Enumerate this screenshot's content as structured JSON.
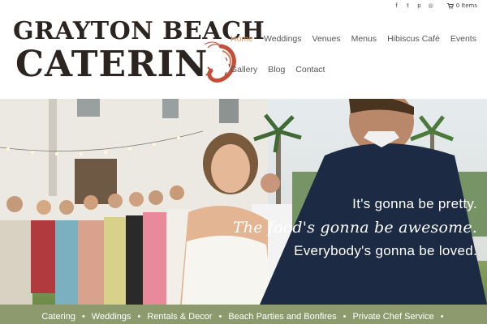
{
  "topbar": {
    "social_icons": [
      "facebook-icon",
      "twitter-icon",
      "pinterest-icon",
      "instagram-icon"
    ],
    "social_glyphs": [
      "f",
      "t",
      "p",
      "◎"
    ],
    "cart_text": "0 Items"
  },
  "logo": {
    "line1": "GRAYTON BEACH",
    "line2": "CATERIN",
    "trailing_graphic": "shrimp-icon"
  },
  "nav": {
    "items": [
      {
        "label": "Home",
        "active": true
      },
      {
        "label": "Weddings"
      },
      {
        "label": "Venues"
      },
      {
        "label": "Menus"
      },
      {
        "label": "Hibiscus Café"
      },
      {
        "label": "Events"
      },
      {
        "label": "Gallery"
      },
      {
        "label": "Blog"
      },
      {
        "label": "Contact"
      }
    ],
    "active_color": "#e8995a"
  },
  "hero": {
    "tagline_1": "It's gonna be pretty.",
    "tagline_2": "The food's gonna be awesome.",
    "tagline_3": "Everybody's gonna be loved."
  },
  "services": {
    "items": [
      "Catering",
      "Weddings",
      "Rentals & Decor",
      "Beach Parties and Bonfires",
      "Private Chef Service"
    ],
    "separator": "•",
    "bar_color": "#8c9a6d"
  }
}
